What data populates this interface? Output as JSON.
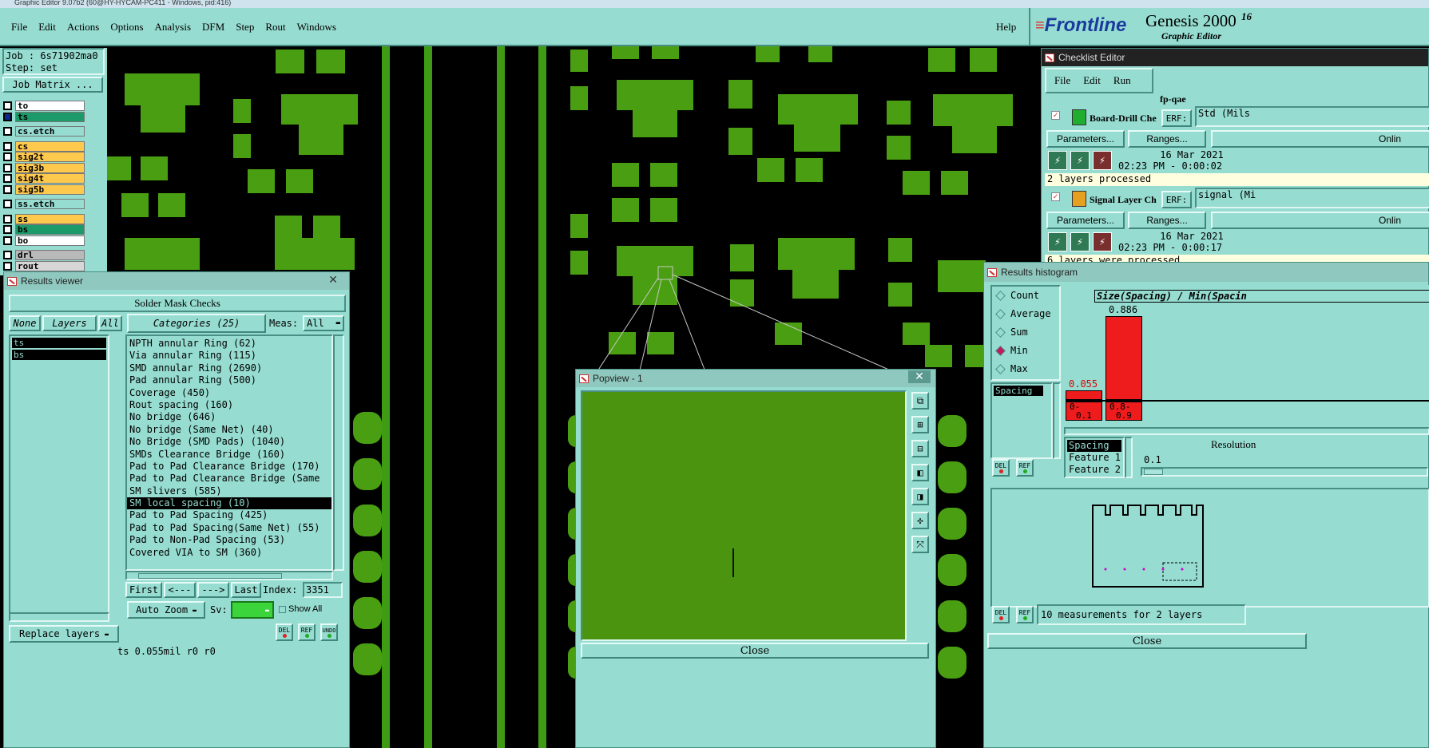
{
  "window_title": "Graphic Editor 9.07b2 (60@HY-HYCAM-PC411 - Windows, pid:416)",
  "menu": {
    "file": "File",
    "edit": "Edit",
    "actions": "Actions",
    "options": "Options",
    "analysis": "Analysis",
    "dfm": "DFM",
    "step": "Step",
    "rout": "Rout",
    "windows": "Windows",
    "help": "Help"
  },
  "brand": {
    "logo": "Frontline",
    "product": "Genesis 2000",
    "sub": "Graphic Editor",
    "ver": "16"
  },
  "job": {
    "job_line": "Job : 6s71902ma0",
    "step_line": "Step: set",
    "matrix_btn": "Job Matrix ..."
  },
  "layers": [
    {
      "name": "to",
      "color": "#ffffff",
      "checked": false
    },
    {
      "name": "ts",
      "color": "#1c9a6a",
      "checked": true
    },
    {
      "name": "cs.etch",
      "color": "#96dcd0",
      "checked": false
    },
    {
      "name": "cs",
      "color": "#ffc94d",
      "checked": false
    },
    {
      "name": "sig2t",
      "color": "#ffc94d",
      "checked": false
    },
    {
      "name": "sig3b",
      "color": "#ffc94d",
      "checked": false
    },
    {
      "name": "sig4t",
      "color": "#ffc94d",
      "checked": false
    },
    {
      "name": "sig5b",
      "color": "#ffc94d",
      "checked": false
    },
    {
      "name": "ss.etch",
      "color": "#96dcd0",
      "checked": false
    },
    {
      "name": "ss",
      "color": "#ffc94d",
      "checked": false
    },
    {
      "name": "bs",
      "color": "#1c9a6a",
      "checked": false
    },
    {
      "name": "bo",
      "color": "#ffffff",
      "checked": false
    },
    {
      "name": "drl",
      "color": "#b9b9b9",
      "checked": false
    },
    {
      "name": "rout",
      "color": "#d6d6d6",
      "checked": false
    }
  ],
  "results_viewer": {
    "title": "Results viewer",
    "heading": "Solder Mask Checks",
    "none_btn": "None",
    "layers_btn": "Layers",
    "all_btn": "All",
    "categories_btn": "Categories (25)",
    "meas_label": "Meas:",
    "meas_value": "All",
    "layer_items": [
      "ts",
      "bs"
    ],
    "categories": [
      "NPTH annular Ring (62)",
      "Via annular Ring (115)",
      "SMD annular Ring (2690)",
      "Pad annular Ring (500)",
      "Coverage (450)",
      "Rout spacing (160)",
      "No bridge (646)",
      "No bridge (Same Net) (40)",
      "No Bridge (SMD Pads) (1040)",
      "SMDs Clearance Bridge (160)",
      "Pad to Pad Clearance Bridge (170)",
      "Pad to Pad Clearance Bridge (Same",
      "SM slivers (585)",
      "SM local spacing (10)",
      "Pad to Pad Spacing (425)",
      "Pad to Pad Spacing(Same Net) (55)",
      "Pad to Non-Pad Spacing (53)",
      "Covered VIA to SM (360)"
    ],
    "selected_index": 13,
    "first_btn": "First",
    "prev_btn": "<---",
    "next_btn": "--->",
    "last_btn": "Last",
    "index_label": "Index:",
    "index_value": "3351",
    "autozoom_btn": "Auto Zoom",
    "sv_label": "Sv:",
    "show_all": "Show All",
    "replace_layers": "Replace layers",
    "del": "DEL",
    "ref": "REF",
    "undo": "UNDO",
    "status": "ts 0.055mil  r0  r0"
  },
  "checklist": {
    "title": "Checklist Editor",
    "menu": {
      "file": "File",
      "edit": "Edit",
      "run": "Run"
    },
    "name": "fp-qae",
    "items": [
      {
        "label": "Board-Drill Che",
        "erf": "ERF:",
        "erf_value": "Std (Mils",
        "params": "Parameters...",
        "ranges": "Ranges...",
        "online": "Onlin",
        "date": "16 Mar 2021",
        "time": "02:23 PM - 0:00:02",
        "status": "2 layers processed"
      },
      {
        "label": "Signal Layer Ch",
        "erf": "ERF:",
        "erf_value": "signal (Mi",
        "params": "Parameters...",
        "ranges": "Ranges...",
        "online": "Onlin",
        "date": "16 Mar 2021",
        "time": "02:23 PM - 0:00:17",
        "status": "6 layers were processed"
      }
    ]
  },
  "histogram": {
    "title": "Results histogram",
    "modes": [
      "Count",
      "Average",
      "Sum",
      "Min",
      "Max"
    ],
    "selected_mode": "Min",
    "measure_item": "Spacing",
    "chart_title": "Size(Spacing) / Min(Spacin",
    "bars": [
      {
        "label_top": "0.055",
        "label_bottom": "0-",
        "label_bottom2": "0.1",
        "value": 0.055
      },
      {
        "label_top": "0.886",
        "label_bottom": "0.8-",
        "label_bottom2": "0.9",
        "value": 0.886
      }
    ],
    "fields": [
      "Spacing",
      "Feature 1",
      "Feature 2"
    ],
    "resolution_label": "Resolution",
    "resolution_value": "0.1",
    "summary": "10 measurements for 2 layers",
    "del": "DEL",
    "ref": "REF",
    "close": "Close"
  },
  "popview": {
    "title": "Popview - 1",
    "close": "Close"
  }
}
